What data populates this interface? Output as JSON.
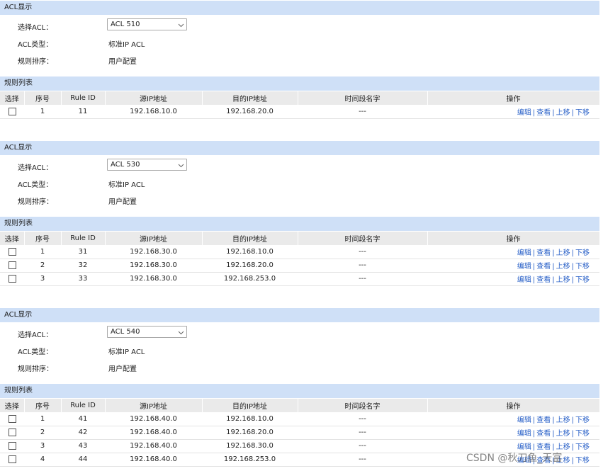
{
  "labels": {
    "section_acl": "ACL显示",
    "select_acl": "选择ACL：",
    "acl_type": "ACL类型：",
    "rule_order": "规则排序：",
    "section_rules": "规则列表"
  },
  "table_headers": [
    "选择",
    "序号",
    "Rule ID",
    "源IP地址",
    "目的IP地址",
    "时间段名字",
    "操作"
  ],
  "ops": {
    "edit": "编辑",
    "view": "查看",
    "up": "上移",
    "down": "下移",
    "sep": "|"
  },
  "acls": [
    {
      "selected": "ACL 510",
      "type": "标准IP ACL",
      "order": "用户配置",
      "rules": [
        {
          "seq": "1",
          "rule_id": "11",
          "src": "192.168.10.0",
          "dst": "192.168.20.0",
          "time": "---"
        }
      ]
    },
    {
      "selected": "ACL 530",
      "type": "标准IP ACL",
      "order": "用户配置",
      "rules": [
        {
          "seq": "1",
          "rule_id": "31",
          "src": "192.168.30.0",
          "dst": "192.168.10.0",
          "time": "---"
        },
        {
          "seq": "2",
          "rule_id": "32",
          "src": "192.168.30.0",
          "dst": "192.168.20.0",
          "time": "---"
        },
        {
          "seq": "3",
          "rule_id": "33",
          "src": "192.168.30.0",
          "dst": "192.168.253.0",
          "time": "---"
        }
      ]
    },
    {
      "selected": "ACL 540",
      "type": "标准IP ACL",
      "order": "用户配置",
      "rules": [
        {
          "seq": "1",
          "rule_id": "41",
          "src": "192.168.40.0",
          "dst": "192.168.10.0",
          "time": "---"
        },
        {
          "seq": "2",
          "rule_id": "42",
          "src": "192.168.40.0",
          "dst": "192.168.20.0",
          "time": "---"
        },
        {
          "seq": "3",
          "rule_id": "43",
          "src": "192.168.40.0",
          "dst": "192.168.30.0",
          "time": "---"
        },
        {
          "seq": "4",
          "rule_id": "44",
          "src": "192.168.40.0",
          "dst": "192.168.253.0",
          "time": "---"
        }
      ]
    }
  ],
  "watermark": "CSDN @秋刀鱼_天富"
}
